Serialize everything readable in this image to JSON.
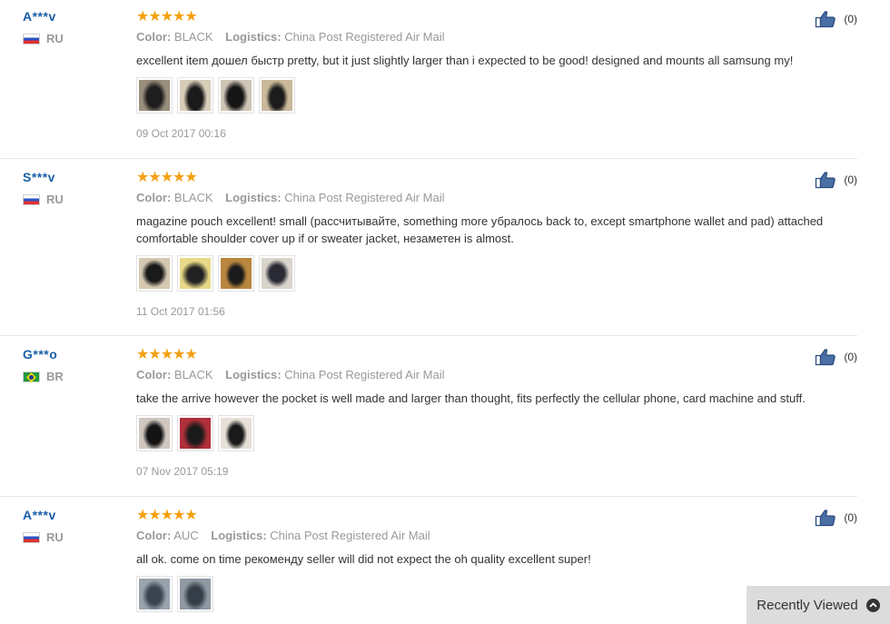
{
  "reviews": [
    {
      "user": "A***v",
      "country": "RU",
      "stars": "★★★★★",
      "color_label": "Color:",
      "color": "BLACK",
      "logistics_label": "Logistics:",
      "logistics": "China Post Registered Air Mail",
      "text": "excellent item дошел быстр pretty, but it just slightly larger than i expected to be good! designed and mounts all samsung my!",
      "date": "09 Oct 2017 00:16",
      "likes": "(0)"
    },
    {
      "user": "S***v",
      "country": "RU",
      "stars": "★★★★★",
      "color_label": "Color:",
      "color": "BLACK",
      "logistics_label": "Logistics:",
      "logistics": "China Post Registered Air Mail",
      "text": "magazine pouch excellent! small (рассчитывайте, something more убралось back to, except smartphone wallet and pad) attached comfortable shoulder cover up if or sweater jacket, незаметен is almost.",
      "date": "11 Oct 2017 01:56",
      "likes": "(0)"
    },
    {
      "user": "G***o",
      "country": "BR",
      "stars": "★★★★★",
      "color_label": "Color:",
      "color": "BLACK",
      "logistics_label": "Logistics:",
      "logistics": "China Post Registered Air Mail",
      "text": "take the arrive however the pocket is well made and larger than thought, fits perfectly the cellular phone, card machine and stuff.",
      "date": "07 Nov 2017 05:19",
      "likes": "(0)"
    },
    {
      "user": "A***v",
      "country": "RU",
      "stars": "★★★★★",
      "color_label": "Color:",
      "color": "AUC",
      "logistics_label": "Logistics:",
      "logistics": "China Post Registered Air Mail",
      "text": "all ok. come on time рекоменду seller will did not expect the oh quality excellent super!",
      "likes": "(0)"
    }
  ],
  "recently_viewed": {
    "label": "Recently Viewed",
    "icon": "chevron-up-icon"
  },
  "colors": {
    "username": "#1a5fa8",
    "stars": "#f5a00f",
    "meta": "#999999"
  }
}
